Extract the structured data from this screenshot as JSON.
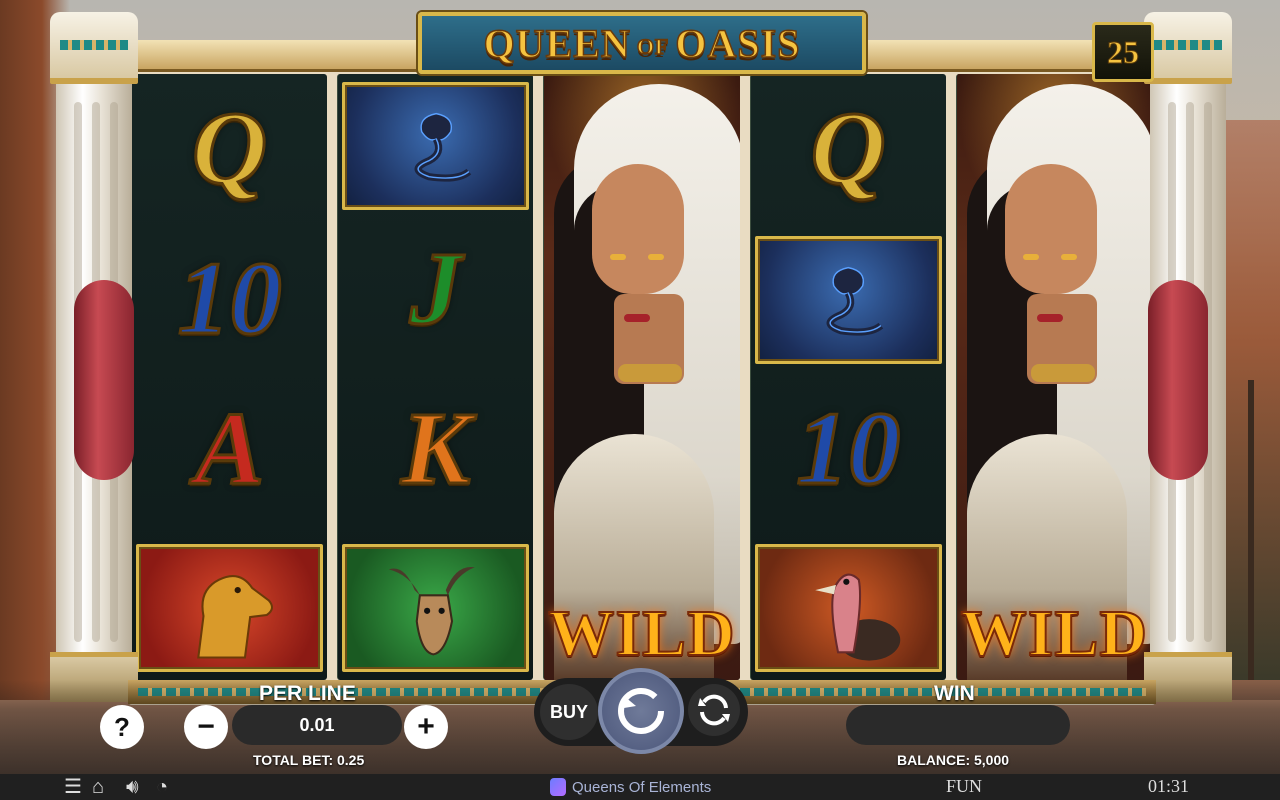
{
  "game": {
    "title_main_1": "QUEEN",
    "title_of": "OF",
    "title_main_2": "OASIS",
    "lines": "25"
  },
  "reels": [
    {
      "symbols": [
        "Q",
        "10",
        "A",
        "camel"
      ]
    },
    {
      "symbols": [
        "cobra",
        "J",
        "K",
        "ibex"
      ]
    },
    {
      "symbols": [
        "queen-wild"
      ]
    },
    {
      "symbols": [
        "Q",
        "cobra",
        "10",
        "vulture"
      ]
    },
    {
      "symbols": [
        "queen-wild"
      ]
    }
  ],
  "wild_label": "WILD",
  "controls": {
    "per_line_label": "PER LINE",
    "per_line_value": "0.01",
    "total_bet": "TOTAL BET: 0.25",
    "buy_label": "BUY",
    "win_label": "WIN",
    "win_value": "",
    "balance": "BALANCE: 5,000",
    "help_label": "?",
    "minus_label": "−",
    "plus_label": "+"
  },
  "footer": {
    "brand": "Queens Of Elements",
    "mode": "FUN",
    "clock": "01:31",
    "icons": [
      "menu-icon",
      "home-icon",
      "sound-icon",
      "turbo-icon"
    ]
  },
  "colors": {
    "gold": "#d9b84a",
    "wild_orange": "#ffb21a",
    "spin_blue": "#5b6688"
  }
}
